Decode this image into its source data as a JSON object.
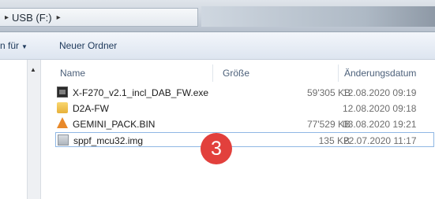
{
  "address": {
    "path": "USB (F:)"
  },
  "toolbar": {
    "partial_item": "n für",
    "new_folder": "Neuer Ordner"
  },
  "columns": {
    "name": "Name",
    "size": "Größe",
    "date": "Änderungsdatum"
  },
  "files": [
    {
      "name": "X-F270_v2.1_incl_DAB_FW.exe",
      "size": "59'305 KB",
      "date": "12.08.2020 09:19",
      "icon": "exe-icon"
    },
    {
      "name": "D2A-FW",
      "size": "",
      "date": "12.08.2020 09:18",
      "icon": "folder-icon"
    },
    {
      "name": "GEMINI_PACK.BIN",
      "size": "77'529 KB",
      "date": "03.08.2020 19:21",
      "icon": "bin-file-icon"
    },
    {
      "name": "sppf_mcu32.img",
      "size": "135 KB",
      "date": "22.07.2020 11:17",
      "icon": "disk-image-icon"
    }
  ],
  "annotation": {
    "step": "3",
    "color": "#e2403c"
  }
}
